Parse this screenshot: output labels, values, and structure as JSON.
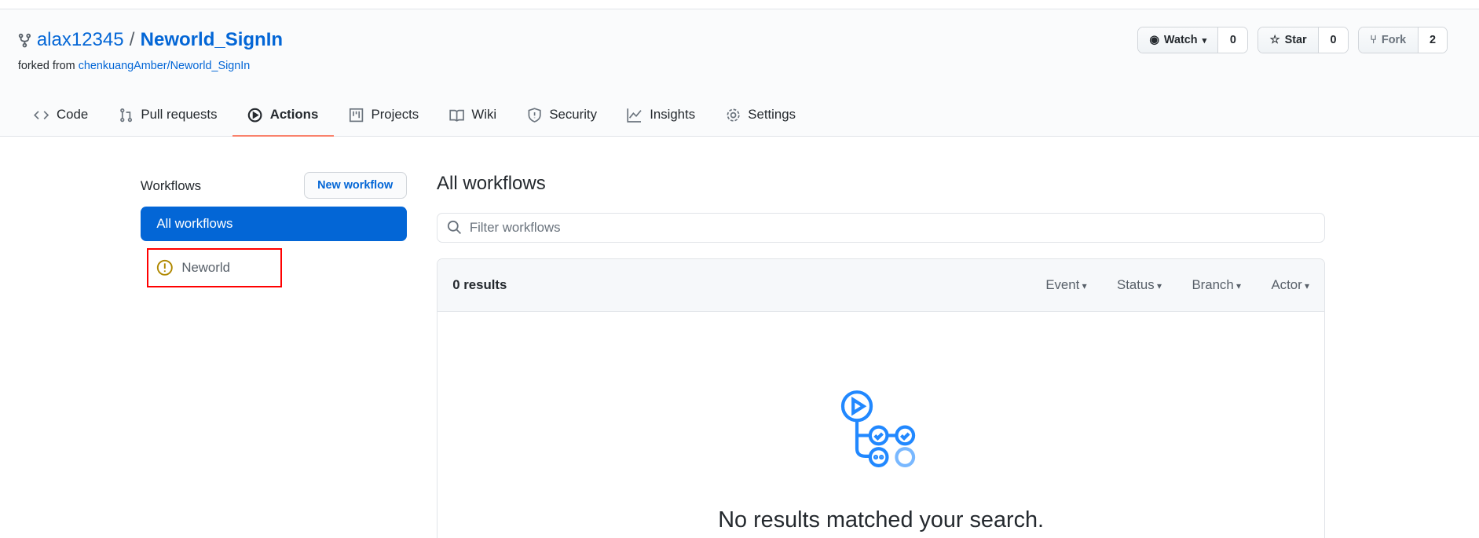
{
  "repo": {
    "owner": "alax12345",
    "separator": "/",
    "name": "Neworld_SignIn",
    "forked_prefix": "forked from",
    "forked_source": "chenkuangAmber/Neworld_SignIn"
  },
  "actions": [
    {
      "label": "Watch",
      "count": "0",
      "icon": "eye-icon",
      "dropdown": true
    },
    {
      "label": "Star",
      "count": "0",
      "icon": "star-icon"
    },
    {
      "label": "Fork",
      "count": "2",
      "icon": "fork-icon"
    }
  ],
  "tabs": [
    {
      "label": "Code",
      "icon": "code-icon"
    },
    {
      "label": "Pull requests",
      "icon": "pull-request-icon"
    },
    {
      "label": "Actions",
      "icon": "play-icon",
      "selected": true
    },
    {
      "label": "Projects",
      "icon": "project-icon"
    },
    {
      "label": "Wiki",
      "icon": "book-icon"
    },
    {
      "label": "Security",
      "icon": "shield-icon"
    },
    {
      "label": "Insights",
      "icon": "graph-icon"
    },
    {
      "label": "Settings",
      "icon": "gear-icon"
    }
  ],
  "sidebar": {
    "title": "Workflows",
    "new_button": "New workflow",
    "items": [
      {
        "label": "All workflows",
        "selected": true
      },
      {
        "label": "Neworld",
        "icon": "alert-icon",
        "status_color": "#b08800"
      }
    ]
  },
  "main": {
    "title": "All workflows",
    "filter_placeholder": "Filter workflows",
    "results_count": "0 results",
    "filters": [
      "Event",
      "Status",
      "Branch",
      "Actor"
    ],
    "empty_message": "No results matched your search."
  },
  "colors": {
    "accent": "#0366d6",
    "tab_underline": "#f9826c",
    "highlight_box": "#ff0000"
  }
}
